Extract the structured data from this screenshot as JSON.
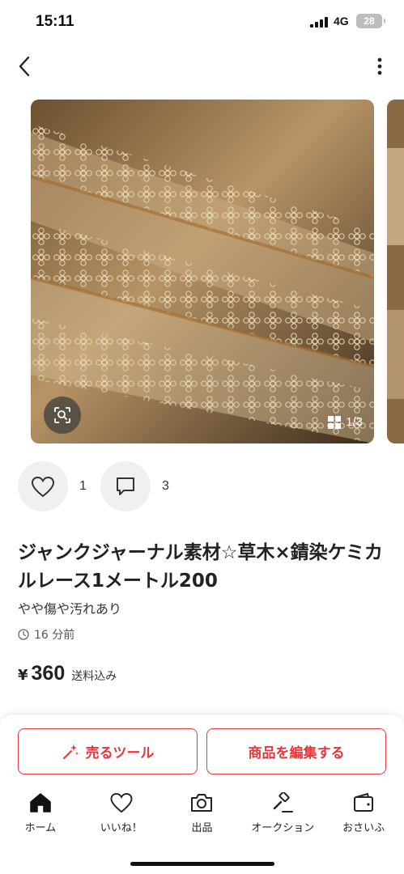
{
  "status_bar": {
    "time": "15:11",
    "network": "4G",
    "battery": "28"
  },
  "gallery": {
    "counter": "1/3"
  },
  "actions": {
    "likes": "1",
    "comments": "3"
  },
  "product": {
    "title": "ジャンクジャーナル素材☆草木×錆染ケミカルレース1メートル200",
    "condition": "やや傷や汚れあり",
    "posted": "16 分前",
    "currency": "¥",
    "price": "360",
    "shipping": "送料込み"
  },
  "buttons": {
    "sell_tool": "売るツール",
    "edit": "商品を編集する"
  },
  "tabs": [
    {
      "label": "ホーム",
      "icon": "home-icon"
    },
    {
      "label": "いいね！",
      "icon": "heart-icon"
    },
    {
      "label": "出品",
      "icon": "camera-icon"
    },
    {
      "label": "オークション",
      "icon": "gavel-icon"
    },
    {
      "label": "おさいふ",
      "icon": "wallet-icon"
    }
  ],
  "colors": {
    "accent": "#e5383b"
  }
}
